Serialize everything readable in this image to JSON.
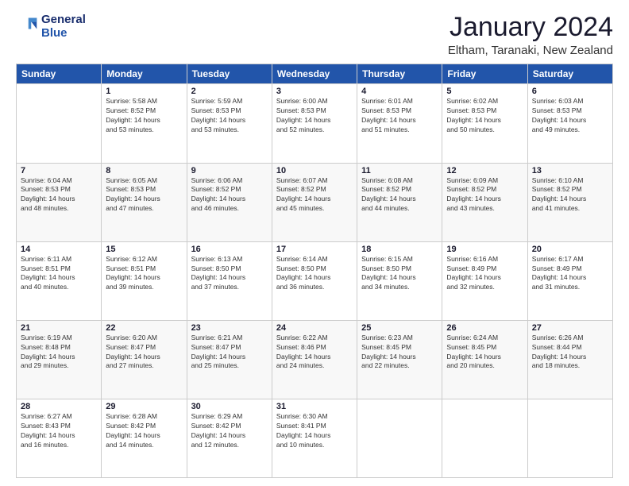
{
  "logo": {
    "line1": "General",
    "line2": "Blue"
  },
  "header": {
    "title": "January 2024",
    "subtitle": "Eltham, Taranaki, New Zealand"
  },
  "weekdays": [
    "Sunday",
    "Monday",
    "Tuesday",
    "Wednesday",
    "Thursday",
    "Friday",
    "Saturday"
  ],
  "weeks": [
    [
      {
        "day": "",
        "info": ""
      },
      {
        "day": "1",
        "info": "Sunrise: 5:58 AM\nSunset: 8:52 PM\nDaylight: 14 hours\nand 53 minutes."
      },
      {
        "day": "2",
        "info": "Sunrise: 5:59 AM\nSunset: 8:53 PM\nDaylight: 14 hours\nand 53 minutes."
      },
      {
        "day": "3",
        "info": "Sunrise: 6:00 AM\nSunset: 8:53 PM\nDaylight: 14 hours\nand 52 minutes."
      },
      {
        "day": "4",
        "info": "Sunrise: 6:01 AM\nSunset: 8:53 PM\nDaylight: 14 hours\nand 51 minutes."
      },
      {
        "day": "5",
        "info": "Sunrise: 6:02 AM\nSunset: 8:53 PM\nDaylight: 14 hours\nand 50 minutes."
      },
      {
        "day": "6",
        "info": "Sunrise: 6:03 AM\nSunset: 8:53 PM\nDaylight: 14 hours\nand 49 minutes."
      }
    ],
    [
      {
        "day": "7",
        "info": "Sunrise: 6:04 AM\nSunset: 8:53 PM\nDaylight: 14 hours\nand 48 minutes."
      },
      {
        "day": "8",
        "info": "Sunrise: 6:05 AM\nSunset: 8:53 PM\nDaylight: 14 hours\nand 47 minutes."
      },
      {
        "day": "9",
        "info": "Sunrise: 6:06 AM\nSunset: 8:52 PM\nDaylight: 14 hours\nand 46 minutes."
      },
      {
        "day": "10",
        "info": "Sunrise: 6:07 AM\nSunset: 8:52 PM\nDaylight: 14 hours\nand 45 minutes."
      },
      {
        "day": "11",
        "info": "Sunrise: 6:08 AM\nSunset: 8:52 PM\nDaylight: 14 hours\nand 44 minutes."
      },
      {
        "day": "12",
        "info": "Sunrise: 6:09 AM\nSunset: 8:52 PM\nDaylight: 14 hours\nand 43 minutes."
      },
      {
        "day": "13",
        "info": "Sunrise: 6:10 AM\nSunset: 8:52 PM\nDaylight: 14 hours\nand 41 minutes."
      }
    ],
    [
      {
        "day": "14",
        "info": "Sunrise: 6:11 AM\nSunset: 8:51 PM\nDaylight: 14 hours\nand 40 minutes."
      },
      {
        "day": "15",
        "info": "Sunrise: 6:12 AM\nSunset: 8:51 PM\nDaylight: 14 hours\nand 39 minutes."
      },
      {
        "day": "16",
        "info": "Sunrise: 6:13 AM\nSunset: 8:50 PM\nDaylight: 14 hours\nand 37 minutes."
      },
      {
        "day": "17",
        "info": "Sunrise: 6:14 AM\nSunset: 8:50 PM\nDaylight: 14 hours\nand 36 minutes."
      },
      {
        "day": "18",
        "info": "Sunrise: 6:15 AM\nSunset: 8:50 PM\nDaylight: 14 hours\nand 34 minutes."
      },
      {
        "day": "19",
        "info": "Sunrise: 6:16 AM\nSunset: 8:49 PM\nDaylight: 14 hours\nand 32 minutes."
      },
      {
        "day": "20",
        "info": "Sunrise: 6:17 AM\nSunset: 8:49 PM\nDaylight: 14 hours\nand 31 minutes."
      }
    ],
    [
      {
        "day": "21",
        "info": "Sunrise: 6:19 AM\nSunset: 8:48 PM\nDaylight: 14 hours\nand 29 minutes."
      },
      {
        "day": "22",
        "info": "Sunrise: 6:20 AM\nSunset: 8:47 PM\nDaylight: 14 hours\nand 27 minutes."
      },
      {
        "day": "23",
        "info": "Sunrise: 6:21 AM\nSunset: 8:47 PM\nDaylight: 14 hours\nand 25 minutes."
      },
      {
        "day": "24",
        "info": "Sunrise: 6:22 AM\nSunset: 8:46 PM\nDaylight: 14 hours\nand 24 minutes."
      },
      {
        "day": "25",
        "info": "Sunrise: 6:23 AM\nSunset: 8:45 PM\nDaylight: 14 hours\nand 22 minutes."
      },
      {
        "day": "26",
        "info": "Sunrise: 6:24 AM\nSunset: 8:45 PM\nDaylight: 14 hours\nand 20 minutes."
      },
      {
        "day": "27",
        "info": "Sunrise: 6:26 AM\nSunset: 8:44 PM\nDaylight: 14 hours\nand 18 minutes."
      }
    ],
    [
      {
        "day": "28",
        "info": "Sunrise: 6:27 AM\nSunset: 8:43 PM\nDaylight: 14 hours\nand 16 minutes."
      },
      {
        "day": "29",
        "info": "Sunrise: 6:28 AM\nSunset: 8:42 PM\nDaylight: 14 hours\nand 14 minutes."
      },
      {
        "day": "30",
        "info": "Sunrise: 6:29 AM\nSunset: 8:42 PM\nDaylight: 14 hours\nand 12 minutes."
      },
      {
        "day": "31",
        "info": "Sunrise: 6:30 AM\nSunset: 8:41 PM\nDaylight: 14 hours\nand 10 minutes."
      },
      {
        "day": "",
        "info": ""
      },
      {
        "day": "",
        "info": ""
      },
      {
        "day": "",
        "info": ""
      }
    ]
  ]
}
